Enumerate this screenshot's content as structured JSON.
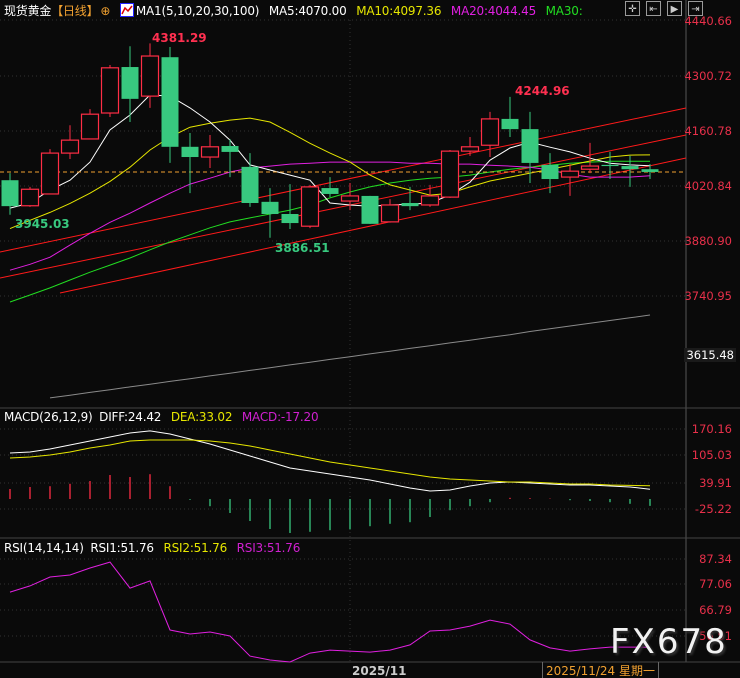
{
  "header": {
    "title": "现货黄金",
    "period": "【日线】",
    "ma_label": "MA1(5,10,20,30,100)",
    "ma5": "MA5:4070.00",
    "ma10": "MA10:4097.36",
    "ma20": "MA20:4044.45",
    "ma30": "MA30:",
    "toolbar_icons": [
      "crosshair-icon",
      "chart-start-icon",
      "play-icon",
      "chart-end-icon"
    ]
  },
  "price_axis": [
    "4440.66",
    "4300.72",
    "4160.78",
    "4020.84",
    "3880.90",
    "3740.95"
  ],
  "price_axis_current": "3615.48",
  "peaks": {
    "high1": "4381.29",
    "low1": "3945.03",
    "low2": "3886.51",
    "high2": "4244.96"
  },
  "macd": {
    "header": {
      "label": "MACD(26,12,9)",
      "diff": "DIFF:24.42",
      "dea": "DEA:33.02",
      "macd": "MACD:-17.20"
    },
    "axis": [
      "170.16",
      "105.03",
      "39.91",
      "-25.22"
    ]
  },
  "rsi": {
    "header": {
      "label": "RSI(14,14,14)",
      "rsi1": "RSI1:51.76",
      "rsi2": "RSI2:51.76",
      "rsi3": "RSI3:51.76"
    },
    "axis": [
      "87.34",
      "77.06",
      "66.79",
      "56.51"
    ]
  },
  "dates": {
    "month": "2025/11",
    "cursor": "2025/11/24 星期一"
  },
  "watermark": "FX678",
  "colors": {
    "up": "#ff2d45",
    "down": "#38c97f",
    "ma5": "#ffffff",
    "ma10": "#e6e600",
    "ma20": "#e020e0",
    "ma30": "#22dd22",
    "ma100": "#8a8a8a",
    "trend": "#ff1a1a"
  },
  "chart_data": {
    "type": "candlestick",
    "candles": [
      [
        4033,
        4051,
        3945,
        3967
      ],
      [
        3968,
        4016,
        3965,
        4010
      ],
      [
        3998,
        4112,
        3998,
        4102
      ],
      [
        4102,
        4173,
        4087,
        4135
      ],
      [
        4138,
        4214,
        4138,
        4201
      ],
      [
        4204,
        4326,
        4194,
        4319
      ],
      [
        4321,
        4374,
        4181,
        4240
      ],
      [
        4247,
        4381.29,
        4217,
        4349
      ],
      [
        4346,
        4372,
        4077,
        4118
      ],
      [
        4118,
        4153,
        4000,
        4092
      ],
      [
        4092,
        4148,
        4064,
        4118
      ],
      [
        4120,
        4138,
        4041,
        4105
      ],
      [
        4067,
        4102,
        3965,
        3975
      ],
      [
        3978,
        4013,
        3886.51,
        3947
      ],
      [
        3947,
        4023,
        3909,
        3924
      ],
      [
        3916,
        4021,
        3911,
        4016
      ],
      [
        4013,
        4041,
        3990,
        3998
      ],
      [
        3980,
        4026,
        3957,
        3993
      ],
      [
        3993,
        3993,
        3922,
        3922
      ],
      [
        3927,
        3985,
        3925,
        3970
      ],
      [
        3975,
        4016,
        3957,
        3967
      ],
      [
        3970,
        4021,
        3965,
        3993
      ],
      [
        3990,
        4110,
        3988,
        4107
      ],
      [
        4107,
        4143,
        4095,
        4118
      ],
      [
        4122,
        4207,
        4092,
        4189
      ],
      [
        4189,
        4244.96,
        4143,
        4163
      ],
      [
        4163,
        4207,
        4026,
        4077
      ],
      [
        4072,
        4102,
        4000,
        4036
      ],
      [
        4041,
        4074,
        3993,
        4056
      ],
      [
        4061,
        4128,
        4051,
        4069
      ],
      [
        4072,
        4105,
        4036,
        4069
      ],
      [
        4069,
        4095,
        4016,
        4061
      ],
      [
        4061,
        4074,
        4036,
        4054
      ]
    ],
    "ma5": [
      3962,
      3975,
      4008,
      4033,
      4079,
      4161,
      4199,
      4250,
      4247,
      4217,
      4181,
      4135,
      4072,
      4059,
      4046,
      4033,
      3975,
      3970,
      3967,
      3970,
      3972,
      3975,
      3995,
      4028,
      4084,
      4115,
      4130,
      4117,
      4105,
      4089,
      4076,
      4072,
      4070
    ],
    "ma10": [
      3910,
      3931,
      3951,
      3974,
      4000,
      4030,
      4066,
      4110,
      4143,
      4168,
      4178,
      4186,
      4191,
      4181,
      4155,
      4127,
      4102,
      4079,
      4046,
      4021,
      4008,
      3995,
      4000,
      4016,
      4031,
      4041,
      4051,
      4061,
      4071,
      4082,
      4092,
      4097,
      4097.36
    ],
    "ma20": [
      3804,
      3819,
      3837,
      3868,
      3898,
      3926,
      3949,
      3975,
      4000,
      4023,
      4038,
      4054,
      4064,
      4069,
      4074,
      4076,
      4079,
      4079,
      4079,
      4079,
      4076,
      4076,
      4074,
      4074,
      4071,
      4069,
      4066,
      4059,
      4048,
      4041,
      4041,
      4041,
      4044.45
    ],
    "ma30": [
      3723,
      3741,
      3759,
      3779,
      3799,
      3817,
      3835,
      3856,
      3876,
      3894,
      3912,
      3927,
      3937,
      3947,
      3957,
      3970,
      3988,
      4003,
      4016,
      4026,
      4033,
      4038,
      4041,
      4046,
      4054,
      4061,
      4066,
      4071,
      4076,
      4079,
      4081,
      4081,
      4081
    ],
    "ma100": [
      null,
      null,
      3479,
      3486,
      3493,
      3500,
      3507,
      3514,
      3521,
      3528,
      3535,
      3542,
      3549,
      3556,
      3563,
      3570,
      3577,
      3584,
      3591,
      3598,
      3605,
      3612,
      3619,
      3626,
      3633,
      3640,
      3648,
      3655,
      3662,
      3669,
      3676,
      3683,
      3690
    ],
    "macd_diff": [
      115,
      117.5,
      125,
      135,
      145,
      155,
      165,
      170.16,
      162.5,
      150,
      137.5,
      122.5,
      107.5,
      92.5,
      77.5,
      70,
      62.5,
      55,
      47.5,
      37.5,
      27.5,
      20,
      22.5,
      32.5,
      40,
      42.5,
      40,
      37.5,
      35,
      35,
      32.5,
      30,
      24.42
    ],
    "macd_dea": [
      102.5,
      105,
      110,
      117.5,
      127.5,
      135,
      145,
      147.5,
      147.5,
      147.5,
      145,
      140,
      132.5,
      122.5,
      112.5,
      102.5,
      92.5,
      85,
      77.5,
      70,
      62.5,
      55,
      50,
      47.5,
      45,
      42.5,
      42.5,
      40,
      37.5,
      37.5,
      35,
      34,
      33.02
    ],
    "macd_hist": [
      25,
      30,
      32,
      38,
      45,
      60,
      55,
      62,
      32,
      -2,
      -18,
      -35,
      -55,
      -75,
      -85,
      -82,
      -78,
      -76,
      -68,
      -62,
      -58,
      -45,
      -28,
      -18,
      -8,
      3,
      2,
      1,
      -3,
      -5,
      -8,
      -12,
      -17.2
    ],
    "rsi": [
      74.0,
      76.5,
      80.1,
      80.9,
      83.7,
      86.1,
      75.6,
      78.5,
      58.7,
      57.1,
      57.9,
      56.3,
      48.2,
      46.6,
      45.8,
      49.4,
      50.6,
      50.2,
      49.8,
      50.6,
      52.7,
      58.3,
      58.7,
      60.3,
      62.7,
      61.1,
      54.7,
      51.5,
      50.2,
      51.1,
      51.8,
      51.8,
      51.76
    ],
    "last_price": 4054,
    "ylim": [
      3615.48,
      4440.66
    ]
  }
}
